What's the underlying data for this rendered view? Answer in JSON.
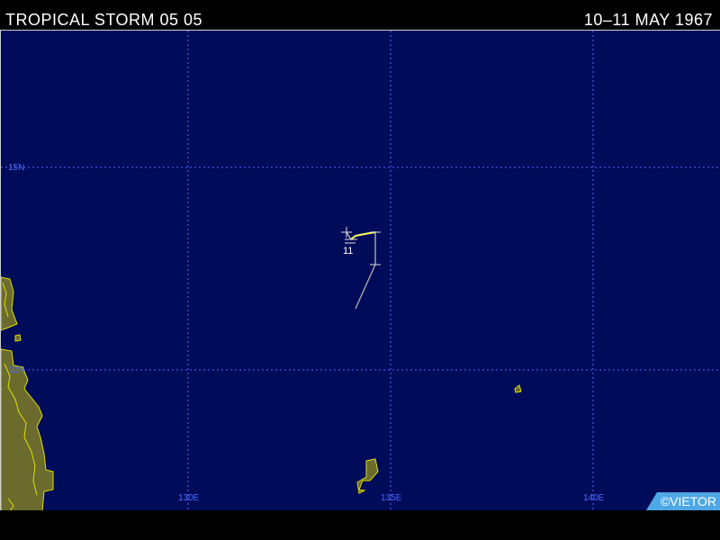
{
  "header": {
    "title": "TROPICAL STORM 05 05",
    "date_range": "10–11 MAY 1967"
  },
  "map": {
    "latitude_labels": [
      "15N",
      "10N"
    ],
    "longitude_labels": [
      "130E",
      "135E",
      "140E"
    ],
    "colors": {
      "ocean": "#000b5a",
      "land": "#6b6b2e",
      "coastline": "#e0e000",
      "grid": "#4f6bff",
      "track_depression": "#a0a0a0",
      "track_storm": "#ffff60"
    },
    "track_marker_label": "11"
  },
  "credit": "©VIETOR"
}
